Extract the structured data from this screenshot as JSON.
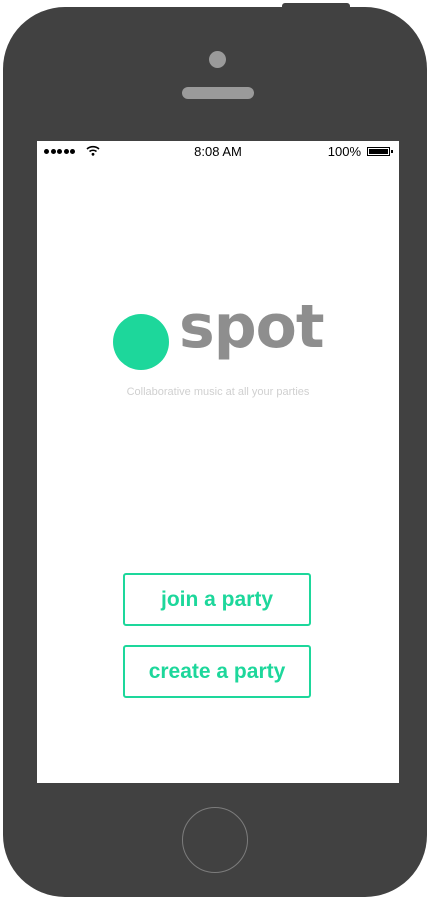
{
  "status_bar": {
    "time": "8:08 AM",
    "battery_percent": "100%",
    "signal_dots": 5,
    "wifi_icon": "wifi-icon",
    "battery_icon": "battery-icon"
  },
  "app": {
    "name": "spot",
    "tagline": "Collaborative music at all your parties",
    "accent_color": "#1dd79b",
    "logo_text_color": "#8e8e8e"
  },
  "actions": {
    "join_label": "join a party",
    "create_label": "create a party"
  },
  "device": {
    "body_color": "#414141"
  }
}
